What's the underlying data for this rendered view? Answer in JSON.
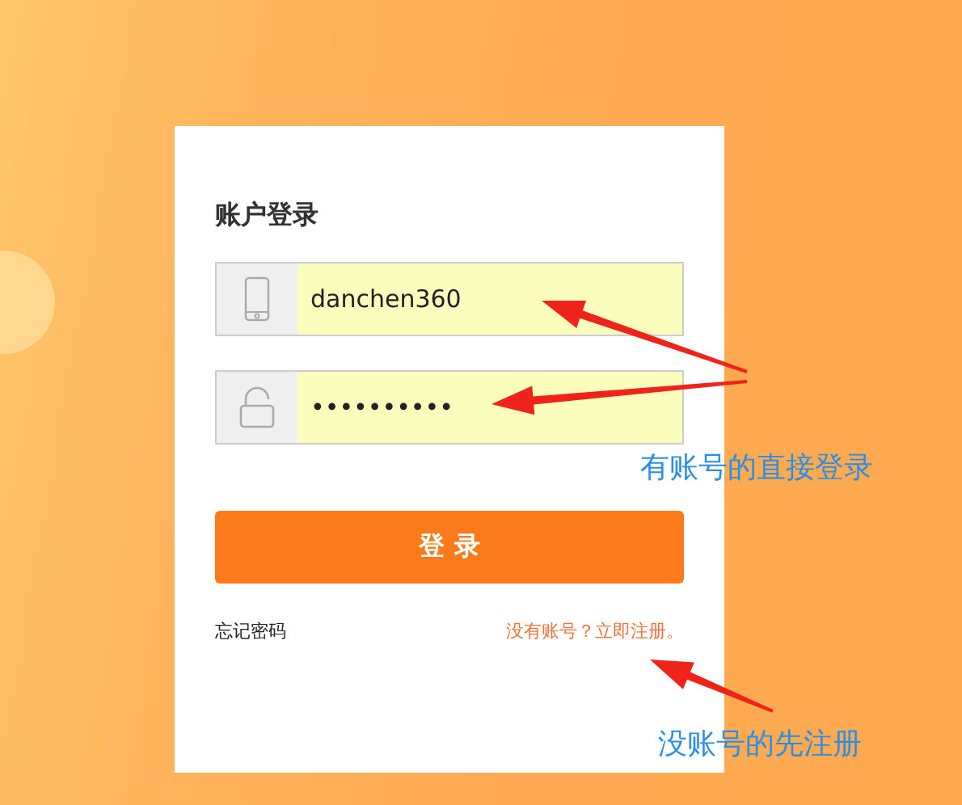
{
  "login": {
    "title": "账户登录",
    "fields": [
      {
        "kind": "phone",
        "value": "danchen360"
      },
      {
        "kind": "lock",
        "value": "••••••••••"
      }
    ],
    "submit": "登 录",
    "forgot": "忘记密码",
    "register": "没有账号？立即注册。"
  },
  "annotations": [
    {
      "text": "有账号的直接登录"
    },
    {
      "text": "没账号的先注册"
    }
  ]
}
